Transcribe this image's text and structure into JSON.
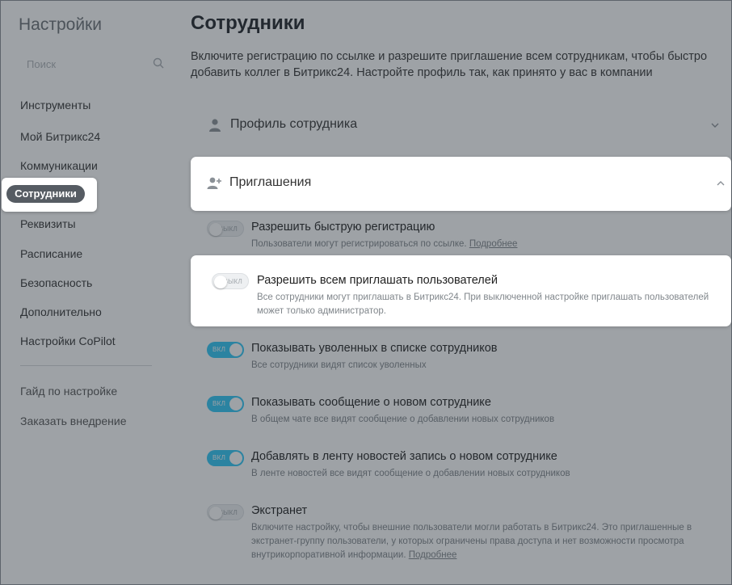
{
  "sidebar": {
    "title": "Настройки",
    "search_placeholder": "Поиск",
    "items": [
      {
        "label": "Инструменты"
      },
      {
        "label": "Мой Битрикс24"
      },
      {
        "label": "Коммуникации"
      },
      {
        "label": "Сотрудники",
        "active": true
      },
      {
        "label": "Реквизиты"
      },
      {
        "label": "Расписание"
      },
      {
        "label": "Безопасность"
      },
      {
        "label": "Дополнительно"
      },
      {
        "label": "Настройки CoPilot"
      }
    ],
    "secondary": [
      {
        "label": "Гайд по настройке"
      },
      {
        "label": "Заказать внедрение"
      }
    ]
  },
  "main": {
    "title": "Сотрудники",
    "description": "Включите регистрацию по ссылке и разрешите приглашение всем сотрудникам, чтобы быстро добавить коллег в Битрикс24. Настройте профиль так, как принято у вас в компании",
    "sections": [
      {
        "title": "Профиль сотрудника",
        "icon": "person-icon",
        "expanded": false
      },
      {
        "title": "Приглашения",
        "icon": "person-add-icon",
        "expanded": true
      }
    ],
    "settings": [
      {
        "title": "Разрешить быструю регистрацию",
        "desc": "Пользователи могут регистрироваться по ссылке.",
        "link": "Подробнее",
        "state": "off",
        "toggle_label": "ВЫКЛ"
      },
      {
        "title": "Разрешить всем приглашать пользователей",
        "desc": "Все сотрудники могут приглашать в Битрикс24. При выключенной настройке приглашать пользователей может только администратор.",
        "state": "off",
        "toggle_label": "ВЫКЛ"
      },
      {
        "title": "Показывать уволенных в списке сотрудников",
        "desc": "Все сотрудники видят список уволенных",
        "state": "on",
        "toggle_label": "ВКЛ"
      },
      {
        "title": "Показывать сообщение о новом сотруднике",
        "desc": "В общем чате все видят сообщение о добавлении новых сотрудников",
        "state": "on",
        "toggle_label": "ВКЛ"
      },
      {
        "title": "Добавлять в ленту новостей запись о новом сотруднике",
        "desc": "В ленте новостей все видят сообщение о добавлении новых сотрудников",
        "state": "on",
        "toggle_label": "ВКЛ"
      },
      {
        "title": "Экстранет",
        "desc": "Включите настройку, чтобы внешние пользователи могли работать в Битрикс24. Это приглашенные в экстранет-группу пользователи, у которых ограничены права доступа и нет возможности просмотра внутрикорпоративной информации.",
        "link": "Подробнее",
        "state": "off",
        "toggle_label": "ВЫКЛ"
      }
    ]
  },
  "colors": {
    "toggle_on": "#2fc6f6",
    "active_pill": "#565c63",
    "overlay": "#28303a"
  }
}
